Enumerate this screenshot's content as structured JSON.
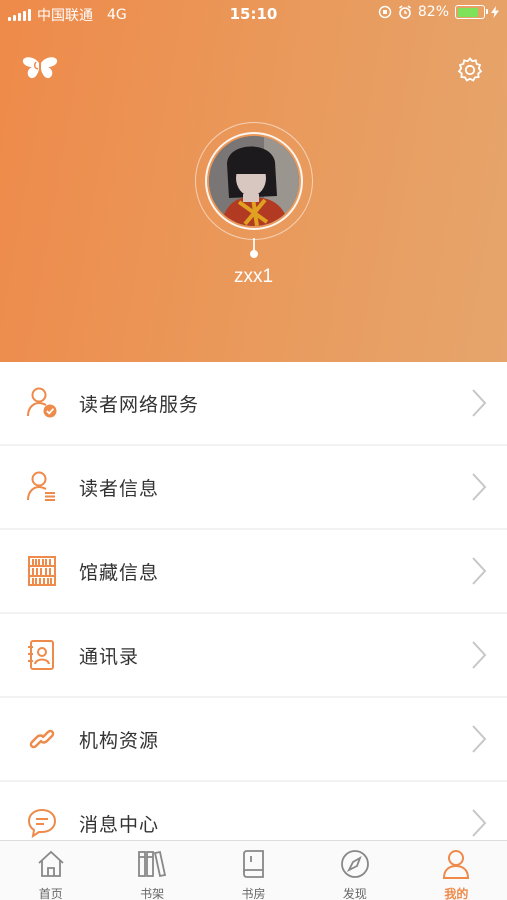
{
  "status_bar": {
    "carrier": "中国联通",
    "network": "4G",
    "time": "15:10",
    "battery_percent": "82%",
    "battery_level": 0.82
  },
  "header": {
    "username": "zxx1",
    "accent_color": "#ee8a4a"
  },
  "menu": {
    "items": [
      {
        "label": "读者网络服务",
        "icon": "user-check-icon"
      },
      {
        "label": "读者信息",
        "icon": "user-info-icon"
      },
      {
        "label": "馆藏信息",
        "icon": "bookshelf-icon"
      },
      {
        "label": "通讯录",
        "icon": "contacts-icon"
      },
      {
        "label": "机构资源",
        "icon": "link-icon"
      },
      {
        "label": "消息中心",
        "icon": "message-icon"
      }
    ]
  },
  "tabbar": {
    "tabs": [
      {
        "label": "首页",
        "icon": "home-icon"
      },
      {
        "label": "书架",
        "icon": "bookshelf-tab-icon"
      },
      {
        "label": "书房",
        "icon": "book-icon"
      },
      {
        "label": "发现",
        "icon": "compass-icon"
      },
      {
        "label": "我的",
        "icon": "profile-icon",
        "active": true
      }
    ]
  }
}
